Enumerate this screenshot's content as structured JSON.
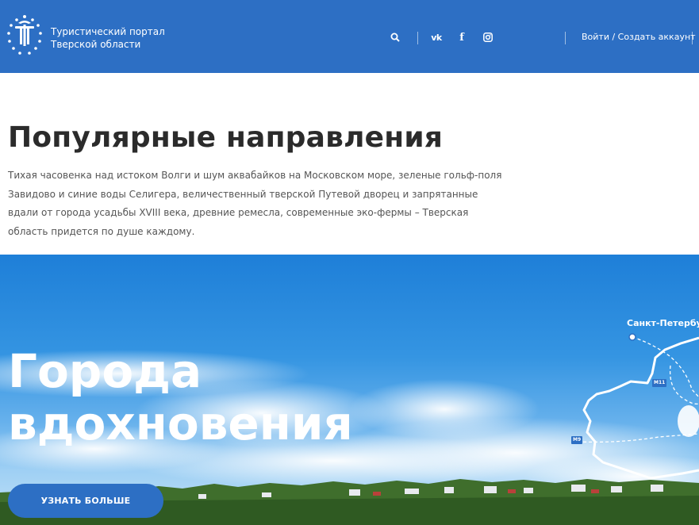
{
  "header": {
    "brand_line1": "Туристический портал",
    "brand_line2": "Тверской области",
    "login_label": "Войти / Создать аккаунт",
    "icons": [
      "search-icon",
      "vk-icon",
      "facebook-icon",
      "instagram-icon"
    ],
    "icon_text": {
      "vk": "vk",
      "facebook": "f"
    }
  },
  "intro": {
    "title": "Популярные направления",
    "text": "Тихая часовенка над истоком Волги и шум аквабайков на Московском море, зеленые гольф-поля Завидово и синие воды Селигера, величественный тверской Путевой дворец и запрятанные вдали от города усадьбы XVIII века, древние ремесла, современные эко-фермы – Тверская область придется по душе каждому."
  },
  "hero": {
    "title_line1": "Города",
    "title_line2": "вдохновения",
    "button_label": "УЗНАТЬ БОЛЬШЕ",
    "map_label": "Санкт-Петербург",
    "road_labels": [
      "М11",
      "М9"
    ]
  },
  "colors": {
    "brand_blue": "#2d6fc4",
    "sky_top": "#1e7fd8",
    "text_dark": "#2b2b2b",
    "text_body": "#555555"
  }
}
